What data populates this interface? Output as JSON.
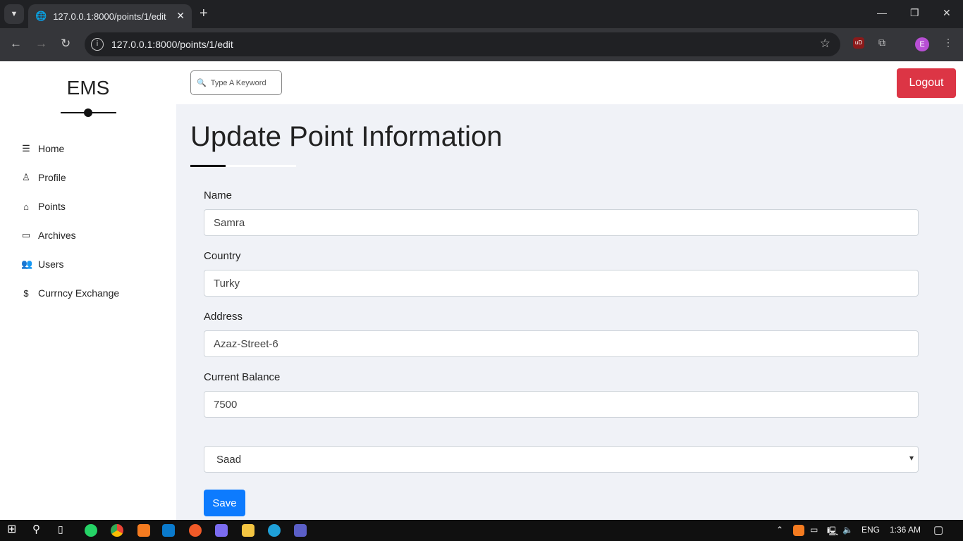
{
  "browser": {
    "tab_title": "127.0.0.1:8000/points/1/edit",
    "url": "127.0.0.1:8000/points/1/edit",
    "profile_initial": "E"
  },
  "sidebar": {
    "logo": "EMS",
    "items": [
      {
        "label": "Home",
        "icon": "chart-icon"
      },
      {
        "label": "Profile",
        "icon": "user-icon"
      },
      {
        "label": "Points",
        "icon": "bank-icon"
      },
      {
        "label": "Archives",
        "icon": "folder-icon"
      },
      {
        "label": "Users",
        "icon": "users-icon"
      },
      {
        "label": "Currncy Exchange",
        "icon": "dollar-icon"
      }
    ]
  },
  "header": {
    "search_placeholder": "Type A Keyword",
    "logout_label": "Logout"
  },
  "main": {
    "title": "Update Point Information",
    "fields": [
      {
        "label": "Name",
        "value": "Samra"
      },
      {
        "label": "Country",
        "value": "Turky"
      },
      {
        "label": "Address",
        "value": "Azaz-Street-6"
      },
      {
        "label": "Current Balance",
        "value": "7500"
      }
    ],
    "select_value": "Saad",
    "save_label": "Save"
  },
  "colors": {
    "logout": "#dc3545",
    "save": "#0d7bfe"
  },
  "taskbar": {
    "lang": "ENG",
    "time": "1:36 AM"
  }
}
